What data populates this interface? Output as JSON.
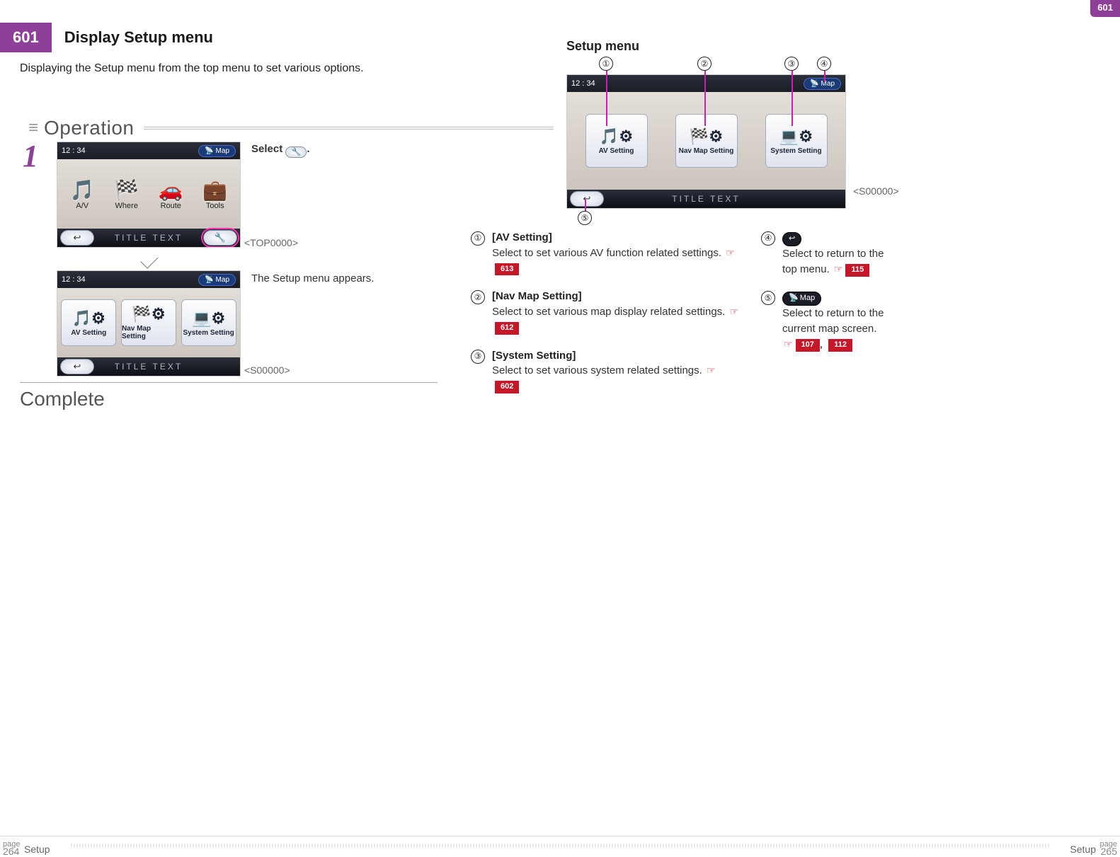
{
  "topright_badge": "601",
  "title_badge": "601",
  "title": "Display Setup menu",
  "subtitle": "Displaying the Setup menu from the top menu to set various options.",
  "operation_label": "Operation",
  "step_number": "1",
  "step_instruction": "Select",
  "select_icon_name": "wrench-icon",
  "shot_time": "12 : 34",
  "shot_map_label": "Map",
  "shot_title_text": "TITLE TEXT",
  "shot1_code": "<TOP0000>",
  "shot2_label": "The Setup menu appears.",
  "shot2_code": "<S00000>",
  "top_menu_items": [
    "A/V",
    "Where",
    "Route",
    "Tools"
  ],
  "setup_tiles": [
    "AV Setting",
    "Nav Map Setting",
    "System Setting"
  ],
  "complete_label": "Complete",
  "right_heading": "Setup menu",
  "right_shot_code": "<S00000>",
  "legend_left": [
    {
      "n": "①",
      "title": "[AV Setting]",
      "desc": "Select to set various AV function related settings.",
      "refs": [
        "613"
      ]
    },
    {
      "n": "②",
      "title": "[Nav Map Setting]",
      "desc": "Select to set various map display related settings.",
      "refs": [
        "612"
      ]
    },
    {
      "n": "③",
      "title": "[System Setting]",
      "desc": "Select to set various system related settings.",
      "refs": [
        "602"
      ]
    }
  ],
  "legend_right": [
    {
      "n": "④",
      "icon": "back",
      "desc": "Select to return to the top menu.",
      "refs": [
        "115"
      ]
    },
    {
      "n": "⑤",
      "icon": "map",
      "desc": "Select to return to the current map screen.",
      "refs": [
        "107",
        "112"
      ]
    }
  ],
  "footer": {
    "left_page_label": "page",
    "left_page": "264",
    "left_section": "Setup",
    "right_section": "Setup",
    "right_page_label": "page",
    "right_page": "265"
  }
}
